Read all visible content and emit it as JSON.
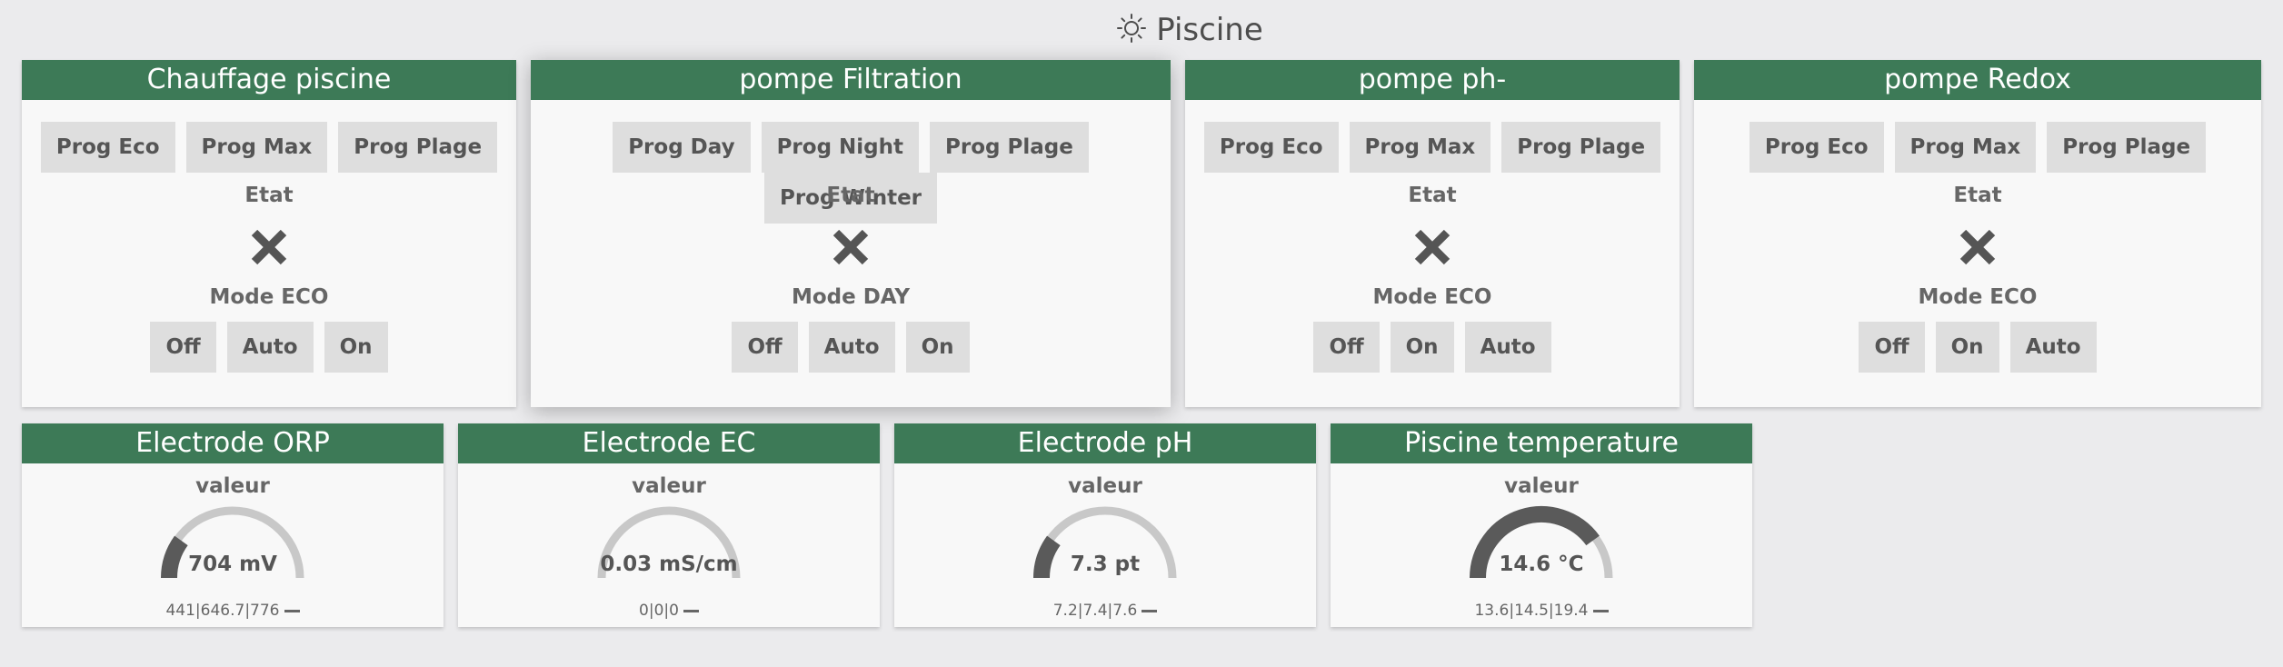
{
  "page": {
    "title": "Piscine",
    "icon": "sun-icon"
  },
  "colors": {
    "header": "#3d7a57",
    "gauge_track": "#c8c8c8",
    "gauge_fill": "#5a5a5a",
    "button_bg": "#dedede"
  },
  "panels": [
    {
      "title": "Chauffage piscine",
      "progs": [
        "Prog Eco",
        "Prog Max",
        "Prog Plage"
      ],
      "state_label": "Etat",
      "state_icon": "cross-icon",
      "mode": "Mode ECO",
      "modes": [
        "Off",
        "Auto",
        "On"
      ]
    },
    {
      "title": "pompe Filtration",
      "progs": [
        "Prog Day",
        "Prog Night",
        "Prog Plage",
        "Prog Winter"
      ],
      "state_label": "Etat",
      "state_icon": "cross-icon",
      "mode": "Mode DAY",
      "modes": [
        "Off",
        "Auto",
        "On"
      ]
    },
    {
      "title": "pompe ph-",
      "progs": [
        "Prog Eco",
        "Prog Max",
        "Prog Plage"
      ],
      "state_label": "Etat",
      "state_icon": "cross-icon",
      "mode": "Mode ECO",
      "modes": [
        "Off",
        "On",
        "Auto"
      ]
    },
    {
      "title": "pompe Redox",
      "progs": [
        "Prog Eco",
        "Prog Max",
        "Prog Plage"
      ],
      "state_label": "Etat",
      "state_icon": "cross-icon",
      "mode": "Mode ECO",
      "modes": [
        "Off",
        "On",
        "Auto"
      ]
    }
  ],
  "sensors": [
    {
      "title": "Electrode ORP",
      "label": "valeur",
      "value": "704 mV",
      "level": 0.2,
      "stats": "441|646.7|776"
    },
    {
      "title": "Electrode EC",
      "label": "valeur",
      "value": "0.03 mS/cm",
      "level": 0.0,
      "stats": "0|0|0"
    },
    {
      "title": "Electrode pH",
      "label": "valeur",
      "value": "7.3 pt",
      "level": 0.2,
      "stats": "7.2|7.4|7.6"
    },
    {
      "title": "Piscine temperature",
      "label": "valeur",
      "value": "14.6 °C",
      "level": 0.8,
      "stats": "13.6|14.5|19.4"
    }
  ]
}
